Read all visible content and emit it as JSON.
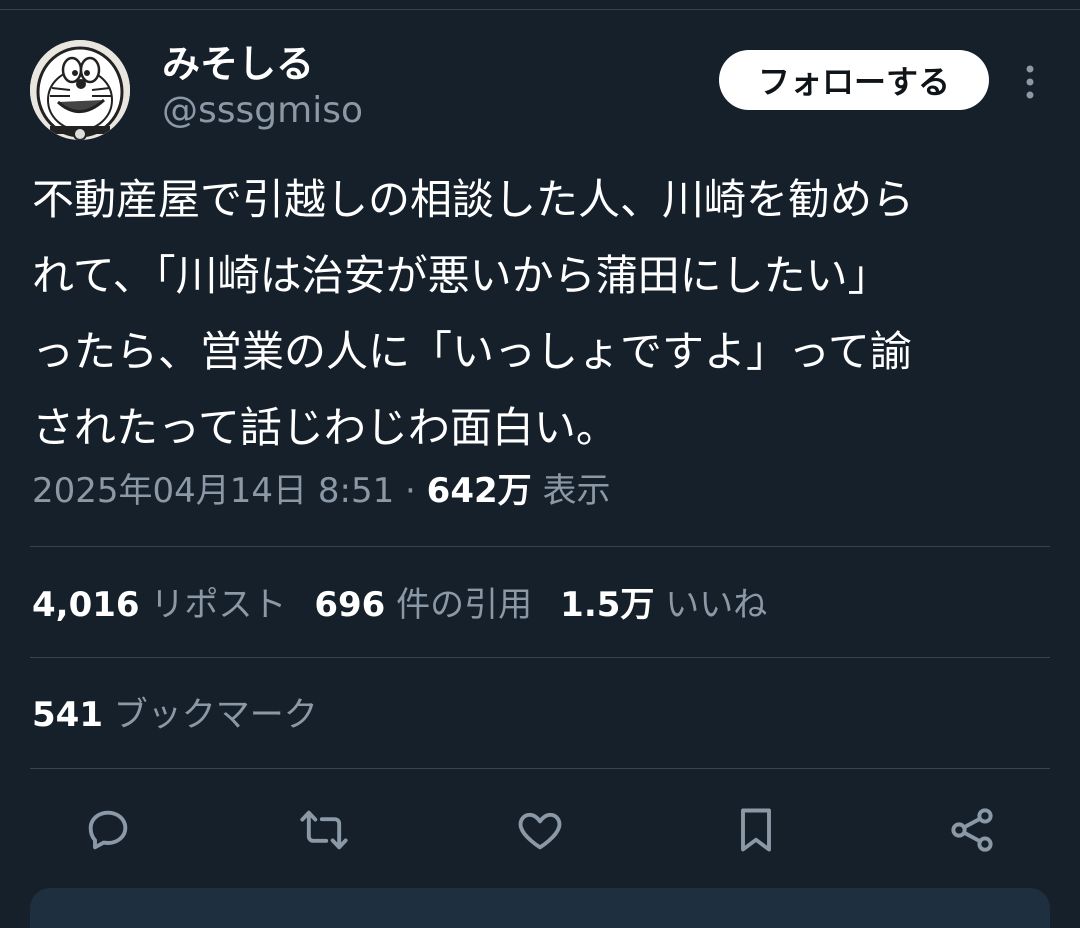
{
  "author": {
    "display_name": "みそしる",
    "handle": "@sssgmiso"
  },
  "follow_button": "フォローする",
  "tweet_lines": [
    "不動産屋で引越しの相談した人、川崎を勧めら",
    "れて、「川崎は治安が悪いから蒲田にしたい」",
    "ったら、営業の人に「いっしょですよ」って諭",
    "されたって話じわじわ面白い。"
  ],
  "meta": {
    "datetime": "2025年04月14日 8:51",
    "separator": "·",
    "views_count": "642万",
    "views_label": "表示"
  },
  "stats": {
    "reposts_count": "4,016",
    "reposts_label": "リポスト",
    "quotes_count": "696",
    "quotes_label": "件の引用",
    "likes_count": "1.5万",
    "likes_label": "いいね",
    "bookmarks_count": "541",
    "bookmarks_label": "ブックマーク"
  },
  "colors": {
    "background": "#15202b",
    "secondary_text": "#8b98a5",
    "divider": "#38444d"
  },
  "actions": [
    "reply-icon",
    "repost-icon",
    "like-icon",
    "bookmark-icon",
    "share-icon"
  ]
}
